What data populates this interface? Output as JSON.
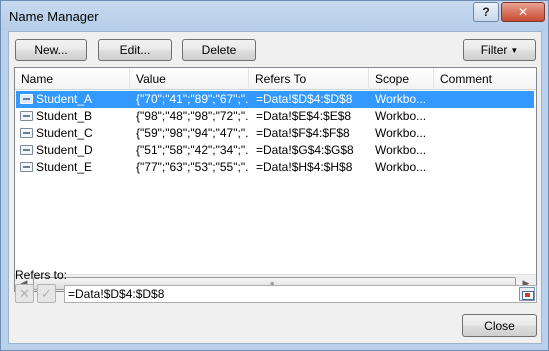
{
  "window": {
    "title": "Name Manager",
    "help_label": "?",
    "close_glyph": "✕"
  },
  "toolbar": {
    "new_label": "New...",
    "edit_label": "Edit...",
    "delete_label": "Delete",
    "filter_label": "Filter"
  },
  "columns": [
    "Name",
    "Value",
    "Refers To",
    "Scope",
    "Comment"
  ],
  "rows": [
    {
      "name": "Student_A",
      "value": "{\"70\";\"41\";\"89\";\"67\";\"...",
      "refers": "=Data!$D$4:$D$8",
      "scope": "Workbo...",
      "comment": "",
      "selected": true
    },
    {
      "name": "Student_B",
      "value": "{\"98\";\"48\";\"98\";\"72\";\"...",
      "refers": "=Data!$E$4:$E$8",
      "scope": "Workbo...",
      "comment": "",
      "selected": false
    },
    {
      "name": "Student_C",
      "value": "{\"59\";\"98\";\"94\";\"47\";\"...",
      "refers": "=Data!$F$4:$F$8",
      "scope": "Workbo...",
      "comment": "",
      "selected": false
    },
    {
      "name": "Student_D",
      "value": "{\"51\";\"58\";\"42\";\"34\";\"...",
      "refers": "=Data!$G$4:$G$8",
      "scope": "Workbo...",
      "comment": "",
      "selected": false
    },
    {
      "name": "Student_E",
      "value": "{\"77\";\"63\";\"53\";\"55\";\"...",
      "refers": "=Data!$H$4:$H$8",
      "scope": "Workbo...",
      "comment": "",
      "selected": false
    }
  ],
  "refers_to": {
    "label": "Refers to:",
    "value": "=Data!$D$4:$D$8"
  },
  "close_label": "Close",
  "icons": {
    "cancel": "x-icon",
    "confirm": "check-icon",
    "collapse": "collapse-dialog-icon",
    "name": "named-range-icon"
  }
}
